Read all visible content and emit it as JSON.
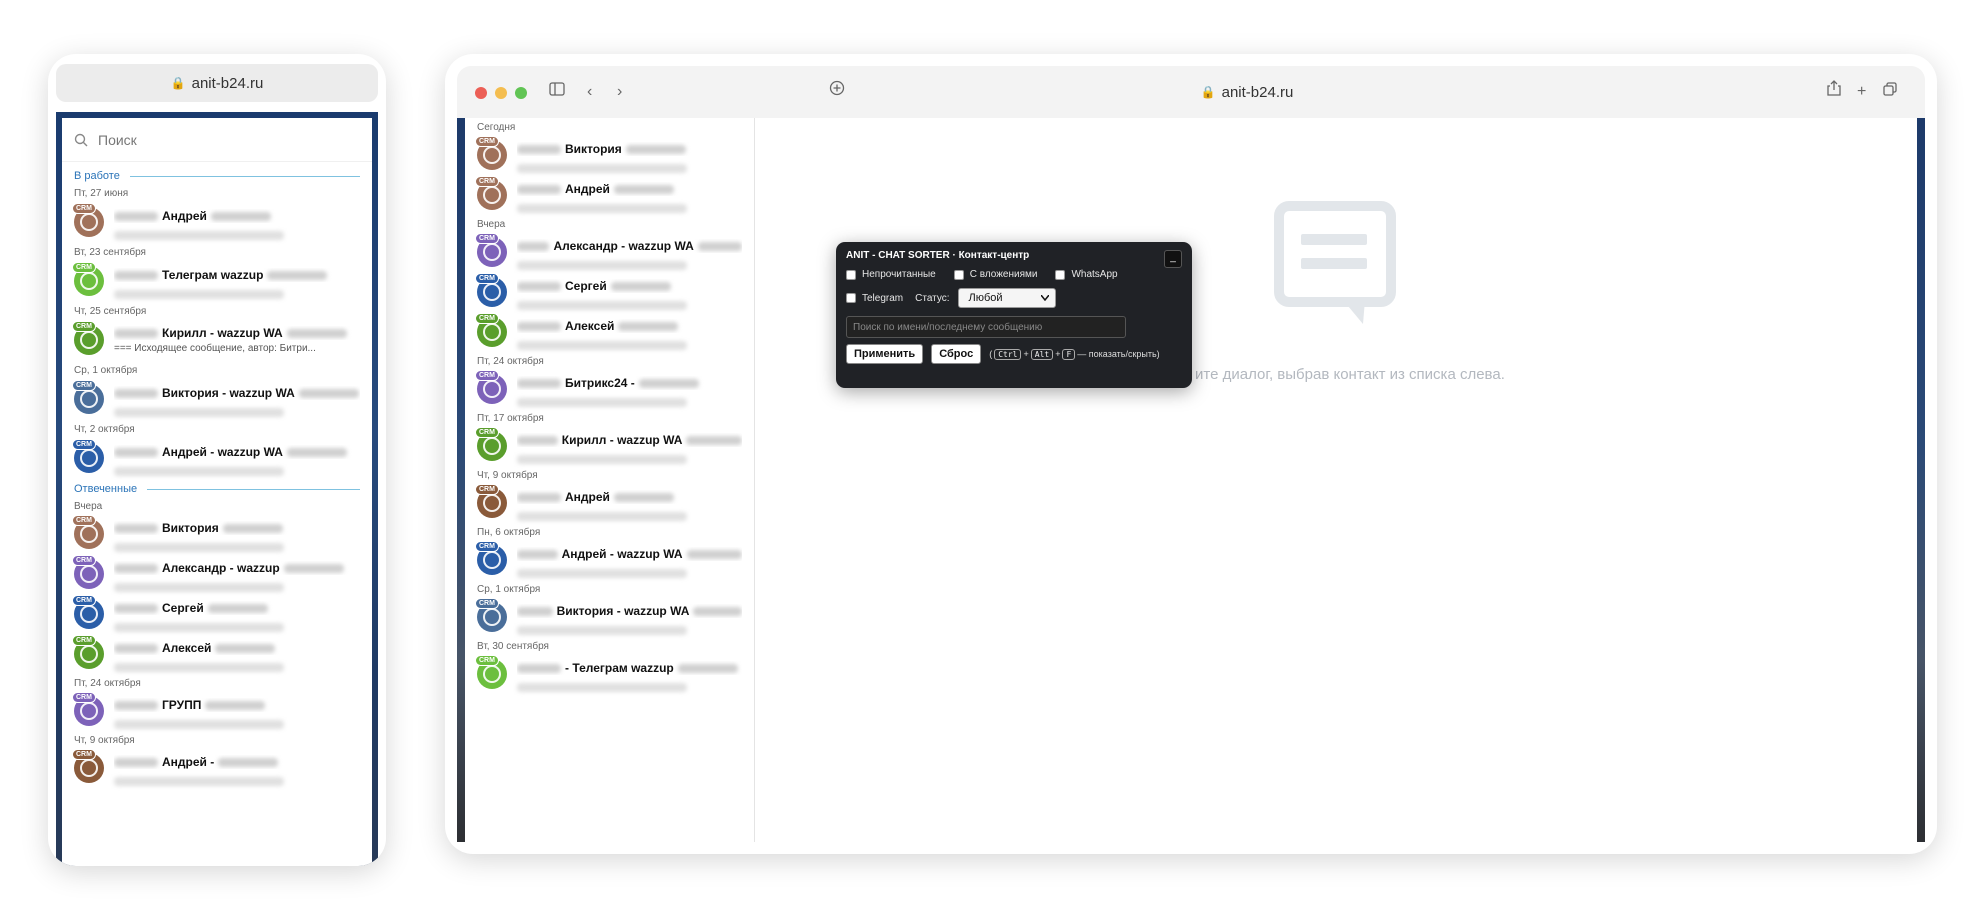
{
  "phone": {
    "url": "anit-b24.ru",
    "search_placeholder": "Поиск",
    "section_work": "В работе",
    "section_answered": "Отвеченные",
    "work_items": [
      {
        "date": "Пт, 27 июня",
        "name": "Андрей",
        "sub": "",
        "color": "#a0715a"
      },
      {
        "date": "Вт, 23 сентября",
        "name": "Телеграм wazzup",
        "sub": "",
        "color": "#6cbf3e"
      },
      {
        "date": "Чт, 25 сентября",
        "name": "Кирилл - wazzup WA",
        "sub": "=== Исходящее сообщение, автор: Битри...",
        "color": "#5a9e2c"
      },
      {
        "date": "Ср, 1 октября",
        "name": "Виктория - wazzup WA",
        "sub": "",
        "color": "#4a6e9a"
      },
      {
        "date": "Чт, 2 октября",
        "name": "Андрей - wazzup WA",
        "sub": "",
        "color": "#2b5ea8"
      }
    ],
    "answered_items": [
      {
        "date": "Вчера",
        "name": "Виктория",
        "sub": "",
        "color": "#a0715a"
      },
      {
        "date": "",
        "name": "Александр - wazzup",
        "sub": "",
        "color": "#7d62b9"
      },
      {
        "date": "",
        "name": "Сергей",
        "sub": "",
        "color": "#2b5ea8"
      },
      {
        "date": "",
        "name": "Алексей",
        "sub": "",
        "color": "#5a9e2c"
      },
      {
        "date": "Пт, 24 октября",
        "name": "ГРУПП",
        "sub": "",
        "color": "#7d62b9"
      },
      {
        "date": "Чт, 9 октября",
        "name": "Андрей -",
        "sub": "",
        "color": "#8a5a3a"
      }
    ]
  },
  "desk": {
    "url": "anit-b24.ru",
    "empty_text": "ите диалог, выбрав контакт из списка слева.",
    "items": [
      {
        "date": "Сегодня",
        "name": "Виктория",
        "color": "#a0715a"
      },
      {
        "date": "",
        "name": "Андрей",
        "color": "#a0715a"
      },
      {
        "date": "Вчера",
        "name": "Александр - wazzup WA",
        "color": "#7d62b9"
      },
      {
        "date": "",
        "name": "Сергей",
        "color": "#2b5ea8"
      },
      {
        "date": "",
        "name": "Алексей",
        "color": "#5a9e2c"
      },
      {
        "date": "Пт, 24 октября",
        "name": "Битрикс24 -",
        "color": "#7d62b9"
      },
      {
        "date": "Пт, 17 октября",
        "name": "Кирилл - wazzup WA",
        "color": "#5a9e2c"
      },
      {
        "date": "Чт, 9 октября",
        "name": "Андрей",
        "color": "#8a5a3a"
      },
      {
        "date": "Пн, 6 октября",
        "name": "Андрей - wazzup WA",
        "color": "#2b5ea8"
      },
      {
        "date": "Ср, 1 октября",
        "name": "Виктория - wazzup WA",
        "color": "#4a6e9a"
      },
      {
        "date": "Вт, 30 сентября",
        "name": "- Телеграм wazzup",
        "color": "#6cbf3e"
      }
    ]
  },
  "sorter": {
    "title": "ANIT - CHAT SORTER · Контакт-центр",
    "min_label": "_",
    "cb_unread": "Непрочитанные",
    "cb_attach": "С вложениями",
    "cb_whatsapp": "WhatsApp",
    "cb_telegram": "Telegram",
    "status_label": "Статус:",
    "status_value": "Любой",
    "search_placeholder": "Поиск по имени/последнему сообщению",
    "apply_label": "Применить",
    "reset_label": "Сброс",
    "key_ctrl": "Ctrl",
    "key_alt": "Alt",
    "key_f": "F",
    "plus": "+",
    "hint": "— показать/скрыть)",
    "paren_open": "("
  },
  "crm_badge": "CRM",
  "colors": {
    "accent": "#2b74b8",
    "popup_bg": "#202226"
  }
}
